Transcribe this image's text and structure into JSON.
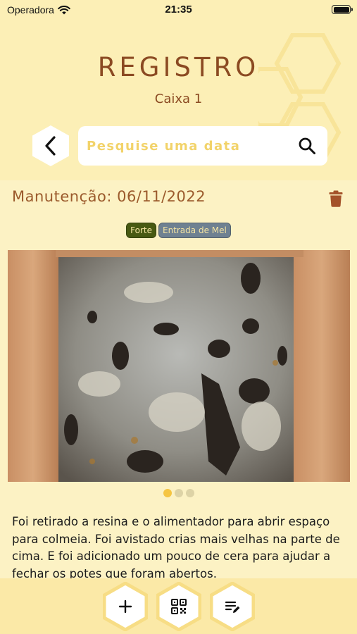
{
  "status_bar": {
    "carrier": "Operadora",
    "time": "21:35"
  },
  "header": {
    "title": "REGISTRO",
    "subtitle": "Caixa 1",
    "search": {
      "placeholder": "Pesquise uma data",
      "value": ""
    }
  },
  "record": {
    "title": "Manutenção: 06/11/2022",
    "tags": [
      "Forte",
      "Entrada de Mel"
    ],
    "photo_count": 3,
    "active_photo": 1,
    "description": "Foi retirado a resina e o alimentador para abrir espaço para colmeia. Foi avistado crias mais velhas na parte de cima. E foi adicionado um pouco de cera para ajudar a fechar os potes que foram abertos."
  },
  "bottom_bar": {
    "buttons": [
      {
        "icon": "plus-icon"
      },
      {
        "icon": "qr-code-icon"
      },
      {
        "icon": "edit-list-icon"
      }
    ]
  },
  "colors": {
    "background": "#fcf2c4",
    "header_background": "#fcefb6",
    "title": "#8b4a22",
    "accent_yellow": "#f5c542",
    "tag_forte": "#485a12",
    "tag_mel": "#6f8191",
    "trash": "#a4522a"
  }
}
